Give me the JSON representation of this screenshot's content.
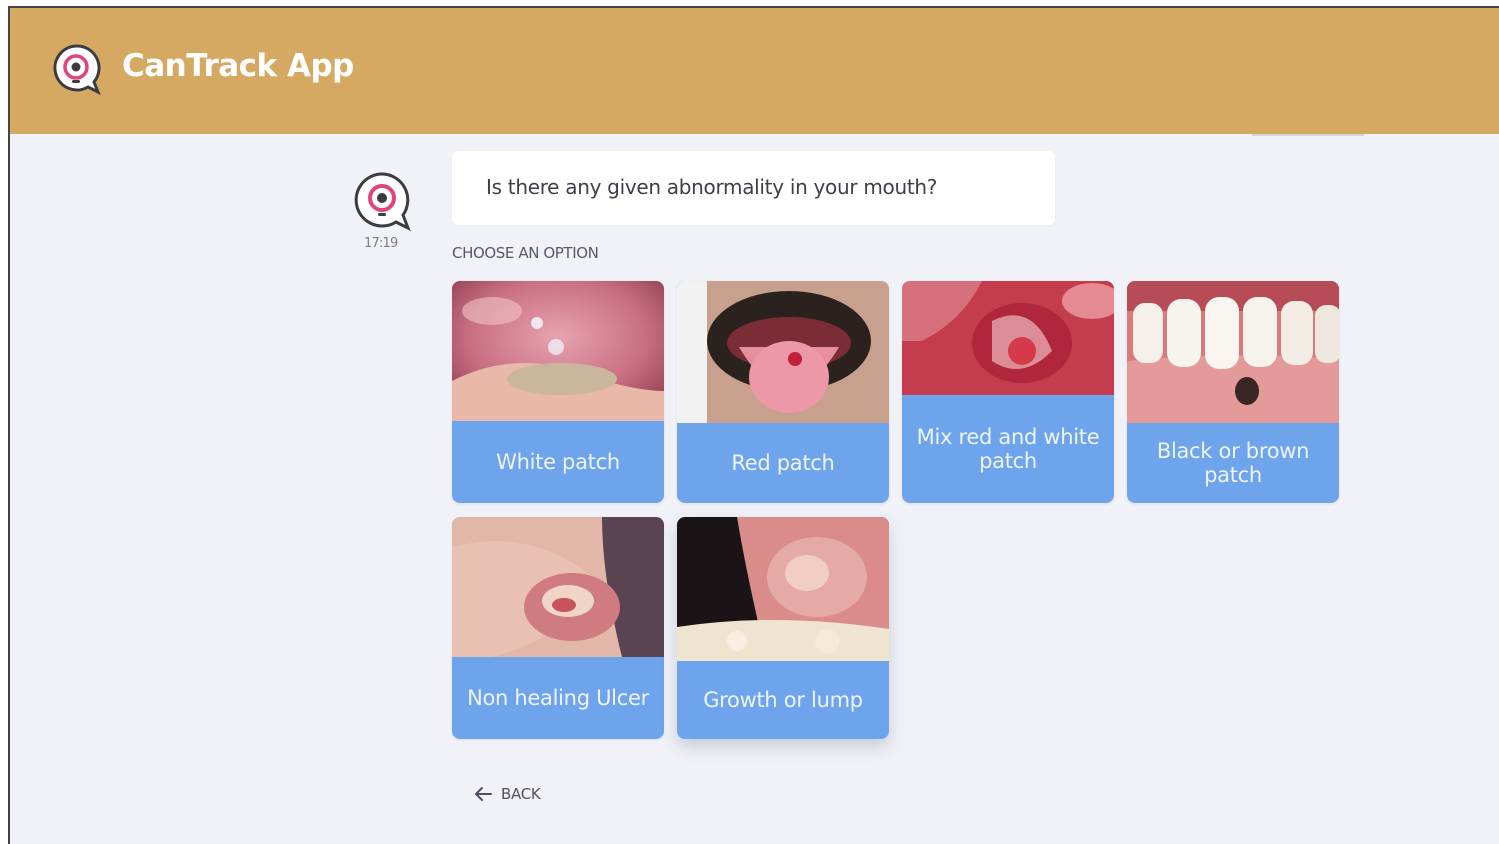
{
  "app": {
    "title": "CanTrack App"
  },
  "message": {
    "text": "Is there any given abnormality in your mouth?",
    "time": "17:19"
  },
  "options": {
    "heading": "CHOOSE AN OPTION",
    "items": [
      {
        "label": "White patch"
      },
      {
        "label": "Red patch"
      },
      {
        "label": "Mix red and white patch"
      },
      {
        "label": "Black or brown patch"
      },
      {
        "label": "Non healing Ulcer"
      },
      {
        "label": "Growth or lump"
      }
    ]
  },
  "nav": {
    "back_label": "BACK"
  },
  "colors": {
    "header": "#d6a963",
    "background": "#f1f2f8",
    "card_label": "#6ea4eb",
    "logo_accent": "#e0447c"
  }
}
